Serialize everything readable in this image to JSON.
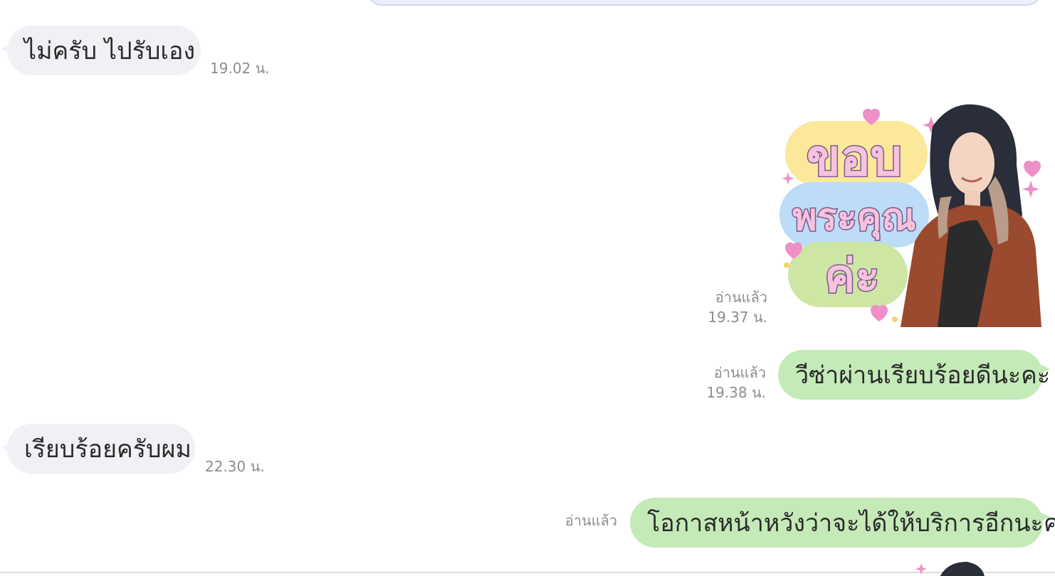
{
  "messages": [
    {
      "id": "m1",
      "direction": "incoming",
      "text": "ไม่ครับ  ไปรับเอง",
      "time": "19.02 น."
    },
    {
      "id": "m2",
      "direction": "outgoing",
      "type": "sticker",
      "sticker_text": [
        "ขอบ",
        "พระคุณ",
        "ค่ะ"
      ],
      "read_label": "อ่านแล้ว",
      "time": "19.37 น."
    },
    {
      "id": "m3",
      "direction": "outgoing",
      "text": "วีซ่าผ่านเรียบร้อยดีนะคะ",
      "read_label": "อ่านแล้ว",
      "time": "19.38 น."
    },
    {
      "id": "m4",
      "direction": "incoming",
      "text": "เรียบร้อยครับผม",
      "time": "22.30 น."
    },
    {
      "id": "m5",
      "direction": "outgoing",
      "text": "โอกาสหน้าหวังว่าจะได้ให้บริการอีกนะคะ",
      "read_label": "อ่านแล้ว"
    }
  ],
  "colors": {
    "incoming_bubble": "#f0f1f4",
    "outgoing_bubble": "#c4eab8",
    "meta_text": "#8d8d8d",
    "message_text": "#2b2b2b"
  },
  "icons": [
    "sticker-heart-icon",
    "sticker-sparkle-icon"
  ]
}
